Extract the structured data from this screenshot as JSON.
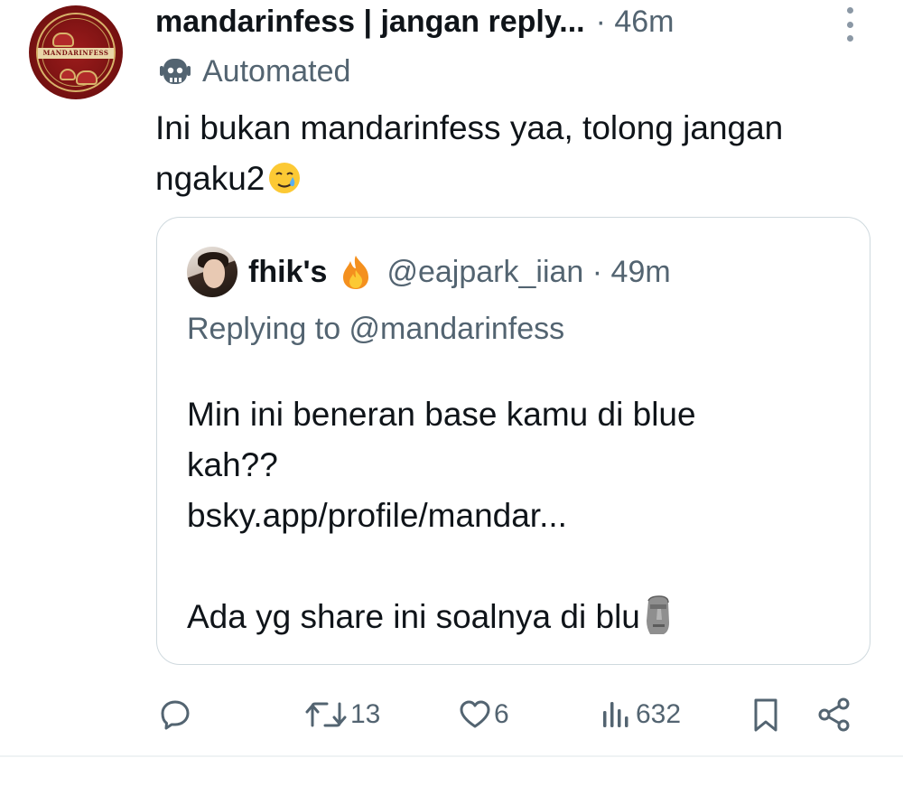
{
  "post": {
    "display_name": "mandarinfess | jangan reply...",
    "time": "· 46m",
    "automated_label": "Automated",
    "text": "Ini bukan mandarinfess yaa, tolong jangan ngaku2",
    "avatar_text": "MANDARINFESS",
    "icons": {
      "more": "more-vertical-icon",
      "automated": "robot-icon",
      "emoji": "face-holding-back-tears-emoji"
    }
  },
  "quote": {
    "name": "fhik's",
    "handle_time": "@eajpark_iian · 49m",
    "replying_to": "Replying to @mandarinfess",
    "lines": [
      "Min ini beneran base kamu di blue",
      "kah??",
      "bsky.app/profile/mandar...",
      "",
      "Ada yg share ini soalnya di blu"
    ],
    "icons": {
      "name_emoji": "fire-emoji",
      "end_emoji": "moai-emoji"
    }
  },
  "actions": {
    "reply_count": "",
    "repost_count": "13",
    "like_count": "6",
    "views_count": "632"
  },
  "colors": {
    "text_primary": "#0f1419",
    "text_secondary": "#536471",
    "border": "#cfd9de",
    "avatar_red": "#9c1c1c",
    "avatar_gold": "#d8b36a"
  }
}
